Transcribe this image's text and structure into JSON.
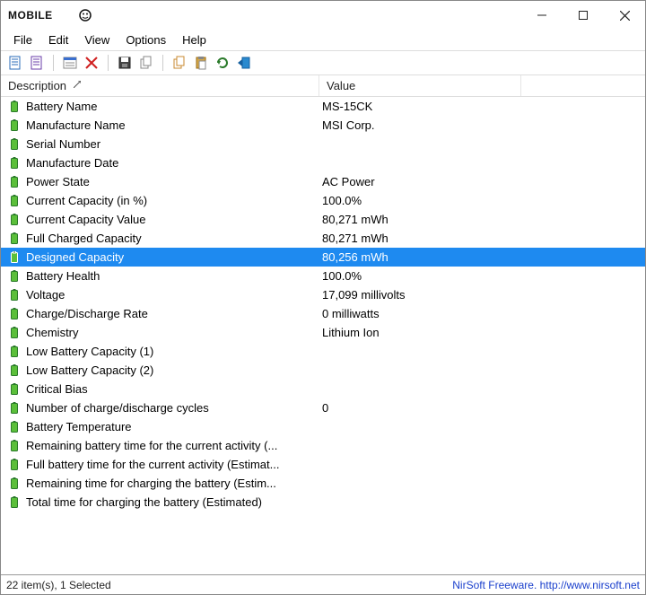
{
  "window": {
    "title_logo": "mobile",
    "title_suffix": ""
  },
  "menu": {
    "items": [
      "File",
      "Edit",
      "View",
      "Options",
      "Help"
    ]
  },
  "columns": {
    "desc": "Description",
    "val": "Value",
    "sort_indicator": "↗"
  },
  "rows": [
    {
      "desc": "Battery Name",
      "val": "MS-15CK"
    },
    {
      "desc": "Manufacture Name",
      "val": "MSI Corp."
    },
    {
      "desc": "Serial Number",
      "val": ""
    },
    {
      "desc": "Manufacture Date",
      "val": ""
    },
    {
      "desc": "Power State",
      "val": "AC Power"
    },
    {
      "desc": "Current Capacity (in %)",
      "val": "100.0%"
    },
    {
      "desc": "Current Capacity Value",
      "val": "80,271 mWh"
    },
    {
      "desc": "Full Charged Capacity",
      "val": "80,271 mWh"
    },
    {
      "desc": "Designed Capacity",
      "val": "80,256 mWh",
      "selected": true
    },
    {
      "desc": "Battery Health",
      "val": "100.0%"
    },
    {
      "desc": "Voltage",
      "val": "17,099 millivolts"
    },
    {
      "desc": "Charge/Discharge Rate",
      "val": "0 milliwatts"
    },
    {
      "desc": "Chemistry",
      "val": "Lithium Ion"
    },
    {
      "desc": "Low Battery Capacity (1)",
      "val": ""
    },
    {
      "desc": "Low Battery Capacity (2)",
      "val": ""
    },
    {
      "desc": "Critical Bias",
      "val": ""
    },
    {
      "desc": "Number of charge/discharge cycles",
      "val": "0"
    },
    {
      "desc": "Battery Temperature",
      "val": ""
    },
    {
      "desc": "Remaining battery time for the current activity (...",
      "val": ""
    },
    {
      "desc": "Full battery time for the current activity (Estimat...",
      "val": ""
    },
    {
      "desc": "Remaining time for charging the battery (Estim...",
      "val": ""
    },
    {
      "desc": "Total  time for charging the battery (Estimated)",
      "val": ""
    }
  ],
  "status": {
    "left": "22 item(s), 1 Selected",
    "right": "NirSoft Freeware.  http://www.nirsoft.net"
  },
  "toolbar_icons": [
    "page-icon",
    "notes-icon",
    "sep",
    "properties-icon",
    "delete-icon",
    "sep",
    "save-icon",
    "copy-icon",
    "sep",
    "copy2-icon",
    "paste-icon",
    "refresh-icon",
    "exit-icon"
  ]
}
